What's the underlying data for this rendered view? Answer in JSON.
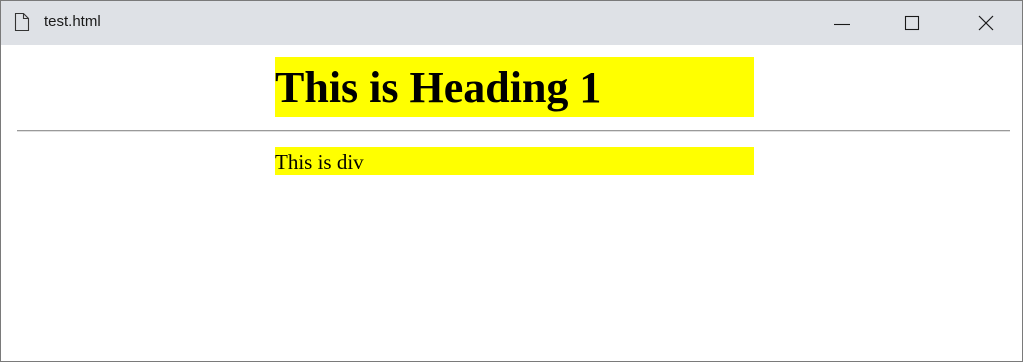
{
  "window": {
    "title": "test.html",
    "icon": "document-icon",
    "controls": [
      "minimize-icon",
      "maximize-icon",
      "close-icon"
    ]
  },
  "page": {
    "heading": "This is Heading 1",
    "div_text": "This is div"
  },
  "colors": {
    "titlebar": "#dee1e6",
    "highlight": "#ffff00",
    "text": "#000000"
  }
}
